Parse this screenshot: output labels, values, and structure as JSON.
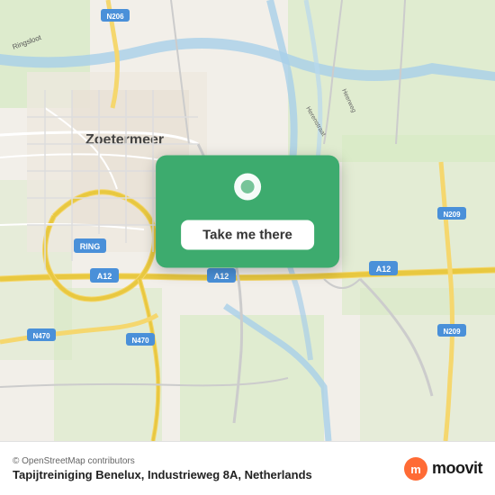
{
  "map": {
    "background_color": "#f2efe9"
  },
  "cta": {
    "button_label": "Take me there"
  },
  "footer": {
    "attribution": "© OpenStreetMap contributors",
    "location_name": "Tapijtreiniging Benelux, Industrieweg 8A, Netherlands",
    "brand": "moovit"
  }
}
